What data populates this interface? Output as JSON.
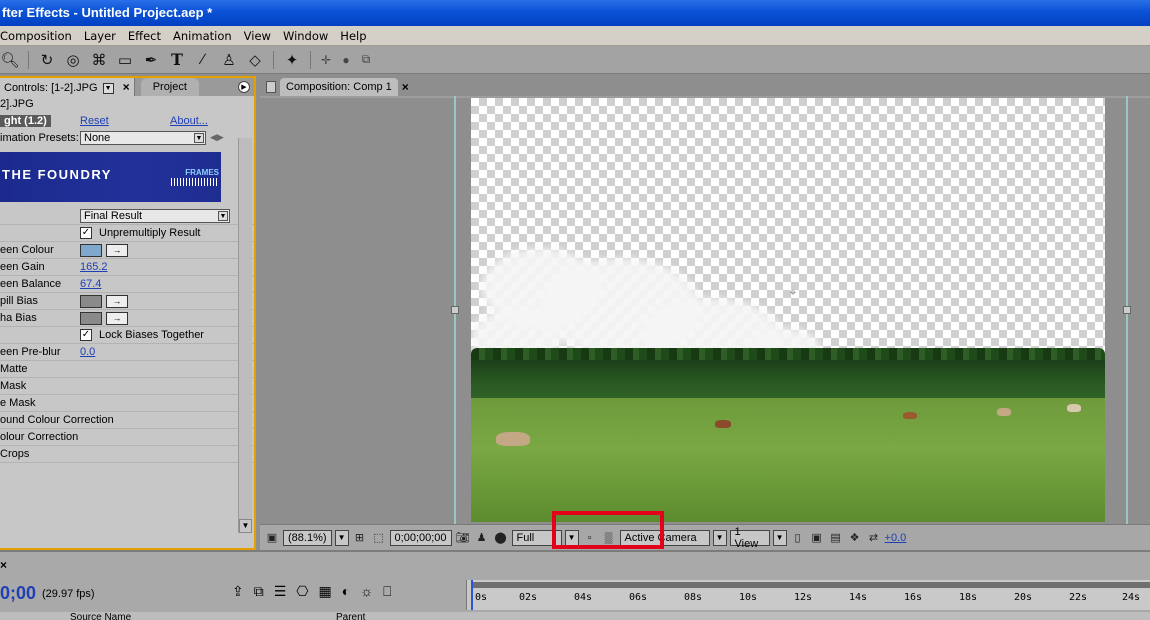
{
  "window": {
    "title": "fter Effects - Untitled Project.aep *"
  },
  "menu": [
    "Composition",
    "Layer",
    "Effect",
    "Animation",
    "View",
    "Window",
    "Help"
  ],
  "tools": [
    "zoom-tool-icon",
    "rotate-tool-icon",
    "orbit-camera-icon",
    "track-xy-icon",
    "rectangle-mask-icon",
    "pen-tool-icon",
    "type-tool-icon",
    "brush-tool-icon",
    "clone-stamp-icon",
    "eraser-tool-icon",
    "puppet-pin-icon"
  ],
  "left_panel": {
    "tab_controls": "Controls: [1-2].JPG",
    "tab_project": "Project",
    "layer_name": "2].JPG",
    "effect_name": "ght (1.2)",
    "reset": "Reset",
    "about": "About...",
    "presets_label": "imation Presets:",
    "presets_value": "None",
    "banner_text": "THE FOUNDRY",
    "banner_frames": "FRAMES",
    "view_value": "Final Result",
    "unpremultiply_label": "Unpremultiply Result",
    "params": [
      {
        "label": "een Colour"
      },
      {
        "label": "een Gain",
        "value": "165.2"
      },
      {
        "label": "een Balance",
        "value": "67.4"
      },
      {
        "label": "pill Bias"
      },
      {
        "label": "ha Bias"
      }
    ],
    "lock_biases_label": "Lock Biases Together",
    "preblur_label": "een Pre-blur",
    "preblur_value": "0.0",
    "groups": [
      "Matte",
      "Mask",
      "e Mask",
      "ound Colour Correction",
      "olour Correction",
      "Crops"
    ]
  },
  "comp_panel": {
    "tab_label": "Composition: Comp 1",
    "magnification": "(88.1%)",
    "timecode": "0;00;00;00",
    "resolution": "Full",
    "camera": "Active Camera",
    "views": "1 View",
    "exposure": "+0.0"
  },
  "timeline": {
    "current_time": "0;00",
    "fps": "(29.97 fps)",
    "ruler_ticks": [
      "0s",
      "02s",
      "04s",
      "06s",
      "08s",
      "10s",
      "12s",
      "14s",
      "16s",
      "18s",
      "20s",
      "22s",
      "24s"
    ],
    "col_source": "Source Name",
    "col_parent": "Parent"
  },
  "colors": {
    "highlight": "#e3001b",
    "panel_focus": "#e3a100",
    "link": "#1f3fb5",
    "green_swatch": "#7fa8cc"
  }
}
